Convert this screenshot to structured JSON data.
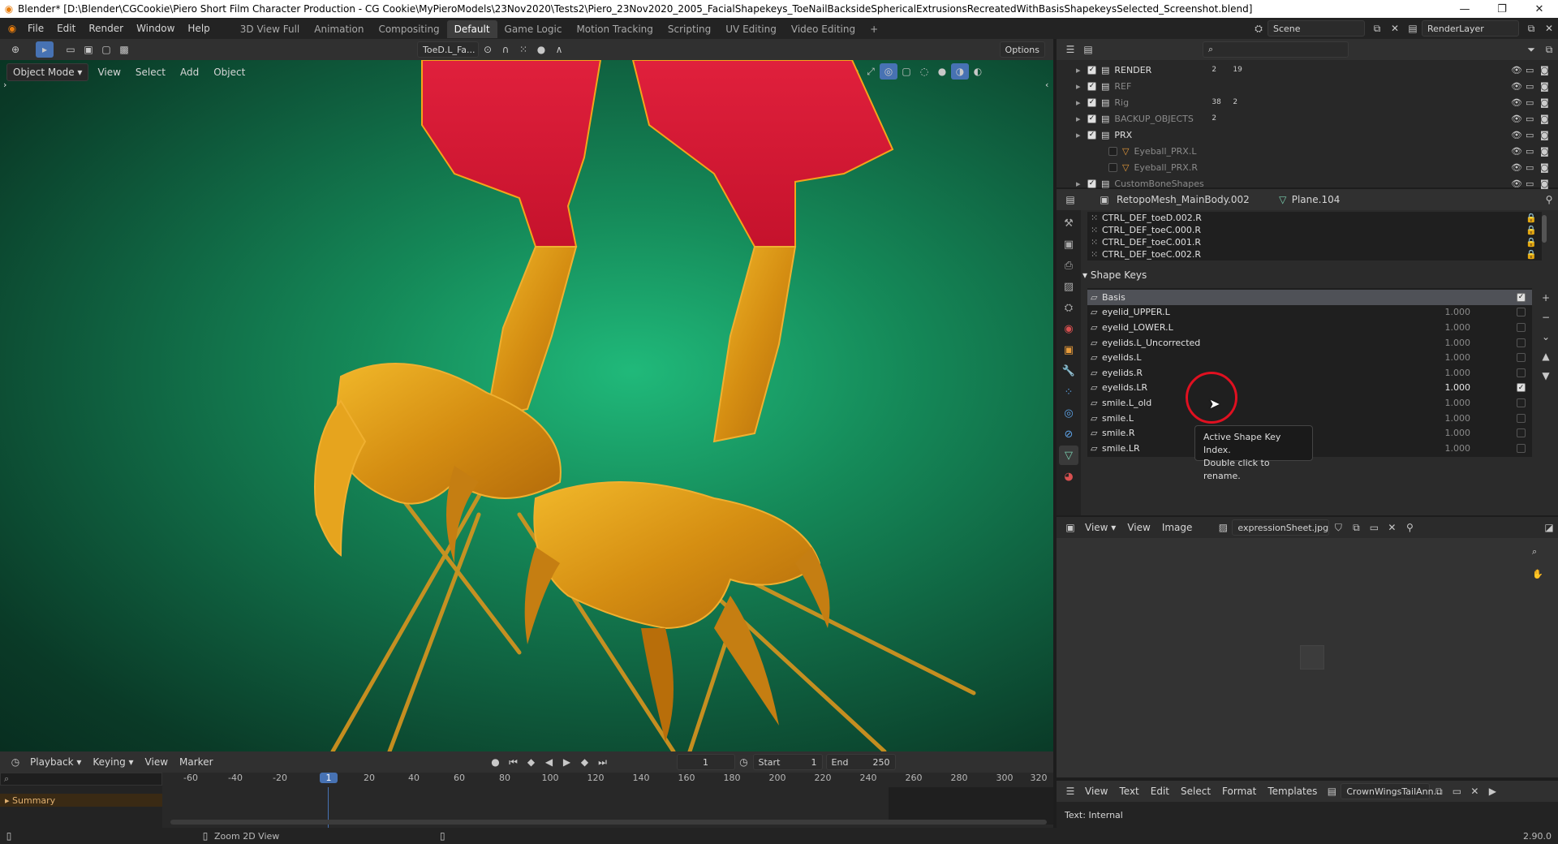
{
  "titlebar": {
    "title": "Blender* [D:\\Blender\\CGCookie\\Piero Short Film Character Production - CG Cookie\\MyPieroModels\\23Nov2020\\Tests2\\Piero_23Nov2020_2005_FacialShapekeys_ToeNailBacksideSphericalExtrusionsRecreatedWithBasisShapekeysSelected_Screenshot.blend]",
    "minimize": "—",
    "maximize": "❐",
    "close": "✕"
  },
  "menubar": {
    "items": [
      "File",
      "Edit",
      "Render",
      "Window",
      "Help"
    ],
    "workspaces": [
      "3D View Full",
      "Animation",
      "Compositing",
      "Default",
      "Game Logic",
      "Motion Tracking",
      "Scripting",
      "UV Editing",
      "Video Editing"
    ],
    "active_workspace": "Default",
    "add_tab": "+",
    "scene": "Scene",
    "render_layer": "RenderLayer"
  },
  "viewport_header": {
    "mode": "Object Mode",
    "menus": [
      "View",
      "Select",
      "Add",
      "Object"
    ],
    "transform_orientation": "ToeD.L_Fa...",
    "options": "Options"
  },
  "outliner": {
    "search_placeholder": "",
    "rows": [
      {
        "name": "RENDER",
        "dim": false,
        "checked": true,
        "badge1": "2",
        "badge2": "19"
      },
      {
        "name": "REF",
        "dim": true,
        "checked": true,
        "badge1": "",
        "badge2": ""
      },
      {
        "name": "Rig",
        "dim": true,
        "checked": true,
        "badge1": "38",
        "badge2": "2"
      },
      {
        "name": "BACKUP_OBJECTS",
        "dim": true,
        "checked": true,
        "badge1": "2",
        "badge2": ""
      },
      {
        "name": "PRX",
        "dim": false,
        "checked": true,
        "badge1": "",
        "badge2": ""
      },
      {
        "name": "Eyeball_PRX.L",
        "dim": true,
        "checked": false,
        "badge1": "",
        "badge2": ""
      },
      {
        "name": "Eyeball_PRX.R",
        "dim": true,
        "checked": false,
        "badge1": "",
        "badge2": ""
      },
      {
        "name": "CustomBoneShapes",
        "dim": true,
        "checked": true,
        "badge1": "",
        "badge2": ""
      }
    ]
  },
  "properties": {
    "object_name": "RetopoMesh_MainBody.002",
    "mesh_name": "Plane.104",
    "vertex_groups": [
      "CTRL_DEF_toeD.002.R",
      "CTRL_DEF_toeC.000.R",
      "CTRL_DEF_toeC.001.R",
      "CTRL_DEF_toeC.002.R"
    ],
    "shape_keys_title": "Shape Keys",
    "shape_keys": [
      {
        "name": "Basis",
        "value": "",
        "checked": true,
        "active": true
      },
      {
        "name": "eyelid_UPPER.L",
        "value": "1.000",
        "checked": false,
        "active": false
      },
      {
        "name": "eyelid_LOWER.L",
        "value": "1.000",
        "checked": false,
        "active": false
      },
      {
        "name": "eyelids.L_Uncorrected",
        "value": "1.000",
        "checked": false,
        "active": false
      },
      {
        "name": "eyelids.L",
        "value": "1.000",
        "checked": false,
        "active": false
      },
      {
        "name": "eyelids.R",
        "value": "1.000",
        "checked": false,
        "active": false
      },
      {
        "name": "eyelids.LR",
        "value": "1.000",
        "checked": true,
        "active": false
      },
      {
        "name": "smile.L_old",
        "value": "1.000",
        "checked": false,
        "active": false
      },
      {
        "name": "smile.L",
        "value": "1.000",
        "checked": false,
        "active": false
      },
      {
        "name": "smile.R",
        "value": "1.000",
        "checked": false,
        "active": false
      },
      {
        "name": "smile.LR",
        "value": "1.000",
        "checked": false,
        "active": false
      }
    ],
    "tooltip_line1": "Active Shape Key Index.",
    "tooltip_line2": "Double click to rename."
  },
  "image_editor": {
    "view_menu": "View",
    "menus": [
      "View",
      "Image"
    ],
    "image_name": "expressionSheet.jpg"
  },
  "text_editor": {
    "menus": [
      "View",
      "Text",
      "Edit",
      "Select",
      "Format",
      "Templates"
    ],
    "text_name": "CrownWingsTailAnn..."
  },
  "timeline": {
    "menus": [
      "Playback",
      "Keying",
      "View",
      "Marker"
    ],
    "current_frame": "1",
    "start_label": "Start",
    "start": "1",
    "end_label": "End",
    "end": "250",
    "ticks": [
      "-60",
      "-40",
      "-20",
      "1",
      "20",
      "40",
      "60",
      "80",
      "100",
      "120",
      "140",
      "160",
      "180",
      "200",
      "220",
      "240",
      "260",
      "280",
      "300",
      "320"
    ],
    "summary": "Summary"
  },
  "statusbar": {
    "hint": "Zoom 2D View",
    "text_internal": "Text: Internal",
    "version": "2.90.0"
  },
  "colors": {
    "accent": "#4772b3",
    "viewport_bg": "#158a59",
    "tooltip_ring": "#e01020"
  }
}
